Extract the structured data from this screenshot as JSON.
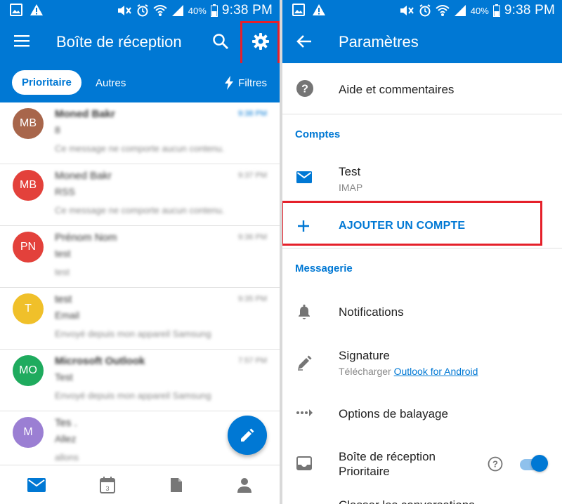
{
  "status_bar": {
    "battery": "40%",
    "time": "9:38 PM"
  },
  "inbox": {
    "title": "Boîte de réception",
    "tabs": [
      "Prioritaire",
      "Autres"
    ],
    "filters_label": "Filtres",
    "messages": [
      {
        "initials": "MB",
        "color": "#a8664b",
        "sender": "Moned Bakr",
        "subject": "8",
        "preview": "Ce message ne comporte aucun contenu.",
        "time": "9:38 PM",
        "unread": true
      },
      {
        "initials": "MB",
        "color": "#e3413b",
        "sender": "Moned Bakr",
        "subject": "RSS",
        "preview": "Ce message ne comporte aucun contenu.",
        "time": "9:37 PM",
        "unread": false
      },
      {
        "initials": "PN",
        "color": "#e3413b",
        "sender": "Prénom Nom",
        "subject": "test",
        "preview": "test",
        "time": "9:36 PM",
        "unread": false
      },
      {
        "initials": "T",
        "color": "#f0c02a",
        "sender": "test",
        "subject": "Email",
        "preview": "Envoyé depuis mon appareil Samsung",
        "time": "9:35 PM",
        "unread": false
      },
      {
        "initials": "MO",
        "color": "#1fab5e",
        "sender": "Microsoft Outlook",
        "subject": "Test",
        "preview": "Envoyé depuis mon appareil Samsung",
        "time": "7:57 PM",
        "unread": false
      },
      {
        "initials": "M",
        "color": "#9b7fd3",
        "sender": "Tes .",
        "subject": "Allez",
        "preview": "allons",
        "time": "",
        "unread": false
      }
    ]
  },
  "settings": {
    "title": "Paramètres",
    "help_label": "Aide et commentaires",
    "accounts_section": "Comptes",
    "account_name": "Test",
    "account_type": "IMAP",
    "add_account_label": "AJOUTER UN COMPTE",
    "messaging_section": "Messagerie",
    "notifications_label": "Notifications",
    "signature_label": "Signature",
    "signature_prefix": "Télécharger",
    "signature_link": "Outlook for Android",
    "swipe_label": "Options de balayage",
    "focused_inbox_line1": "Boîte de réception",
    "focused_inbox_line2": "Prioritaire",
    "focused_inbox_enabled": true,
    "next_item_partial": "Classer les conversations"
  },
  "colors": {
    "accent": "#0078d4",
    "highlight": "#e5202a"
  }
}
